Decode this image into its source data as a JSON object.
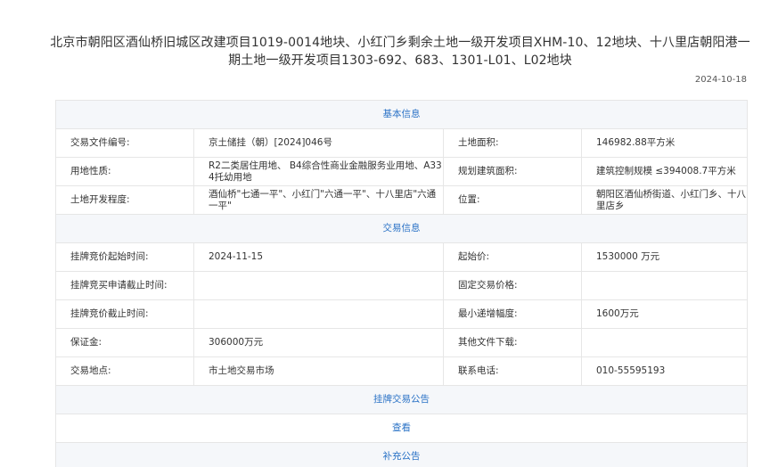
{
  "header": {
    "title": "北京市朝阳区酒仙桥旧城区改建项目1019-0014地块、小红门乡剩余土地一级开发项目XHM-10、12地块、十八里店朝阳港一期土地一级开发项目1303-692、683、1301-L01、L02地块",
    "date": "2024-10-18"
  },
  "basic": {
    "section_title": "基本信息",
    "file_no_label": "交易文件编号:",
    "file_no": "京土储挂（朝）[2024]046号",
    "area_label": "土地面积:",
    "area": "146982.88平方米",
    "use_label": "用地性质:",
    "use": "R2二类居住用地、 B4综合性商业金融服务业用地、A334托幼用地",
    "build_area_label": "规划建筑面积:",
    "build_area": "建筑控制规模 ≤394008.7平方米",
    "dev_label": "土地开发程度:",
    "dev": "酒仙桥\"七通一平\"、小红门\"六通一平\"、十八里店\"六通一平\"",
    "location_label": "位置:",
    "location": "朝阳区酒仙桥街道、小红门乡、十八里店乡"
  },
  "trade": {
    "section_title": "交易信息",
    "bid_start_label": "挂牌竞价起始时间:",
    "bid_start": "2024-11-15",
    "start_price_label": "起始价:",
    "start_price": "1530000 万元",
    "apply_end_label": "挂牌竞买申请截止时间:",
    "apply_end": "",
    "fixed_price_label": "固定交易价格:",
    "fixed_price": "",
    "bid_end_label": "挂牌竞价截止时间:",
    "bid_end": "",
    "min_incr_label": "最小递增幅度:",
    "min_incr": "1600万元",
    "deposit_label": "保证金:",
    "deposit": "306000万元",
    "other_files_label": "其他文件下载:",
    "other_files": "",
    "venue_label": "交易地点:",
    "venue": "市土地交易市场",
    "phone_label": "联系电话:",
    "phone": "010-55595193"
  },
  "links": {
    "announcement": "挂牌交易公告",
    "view": "查看",
    "supplement": "补充公告"
  }
}
